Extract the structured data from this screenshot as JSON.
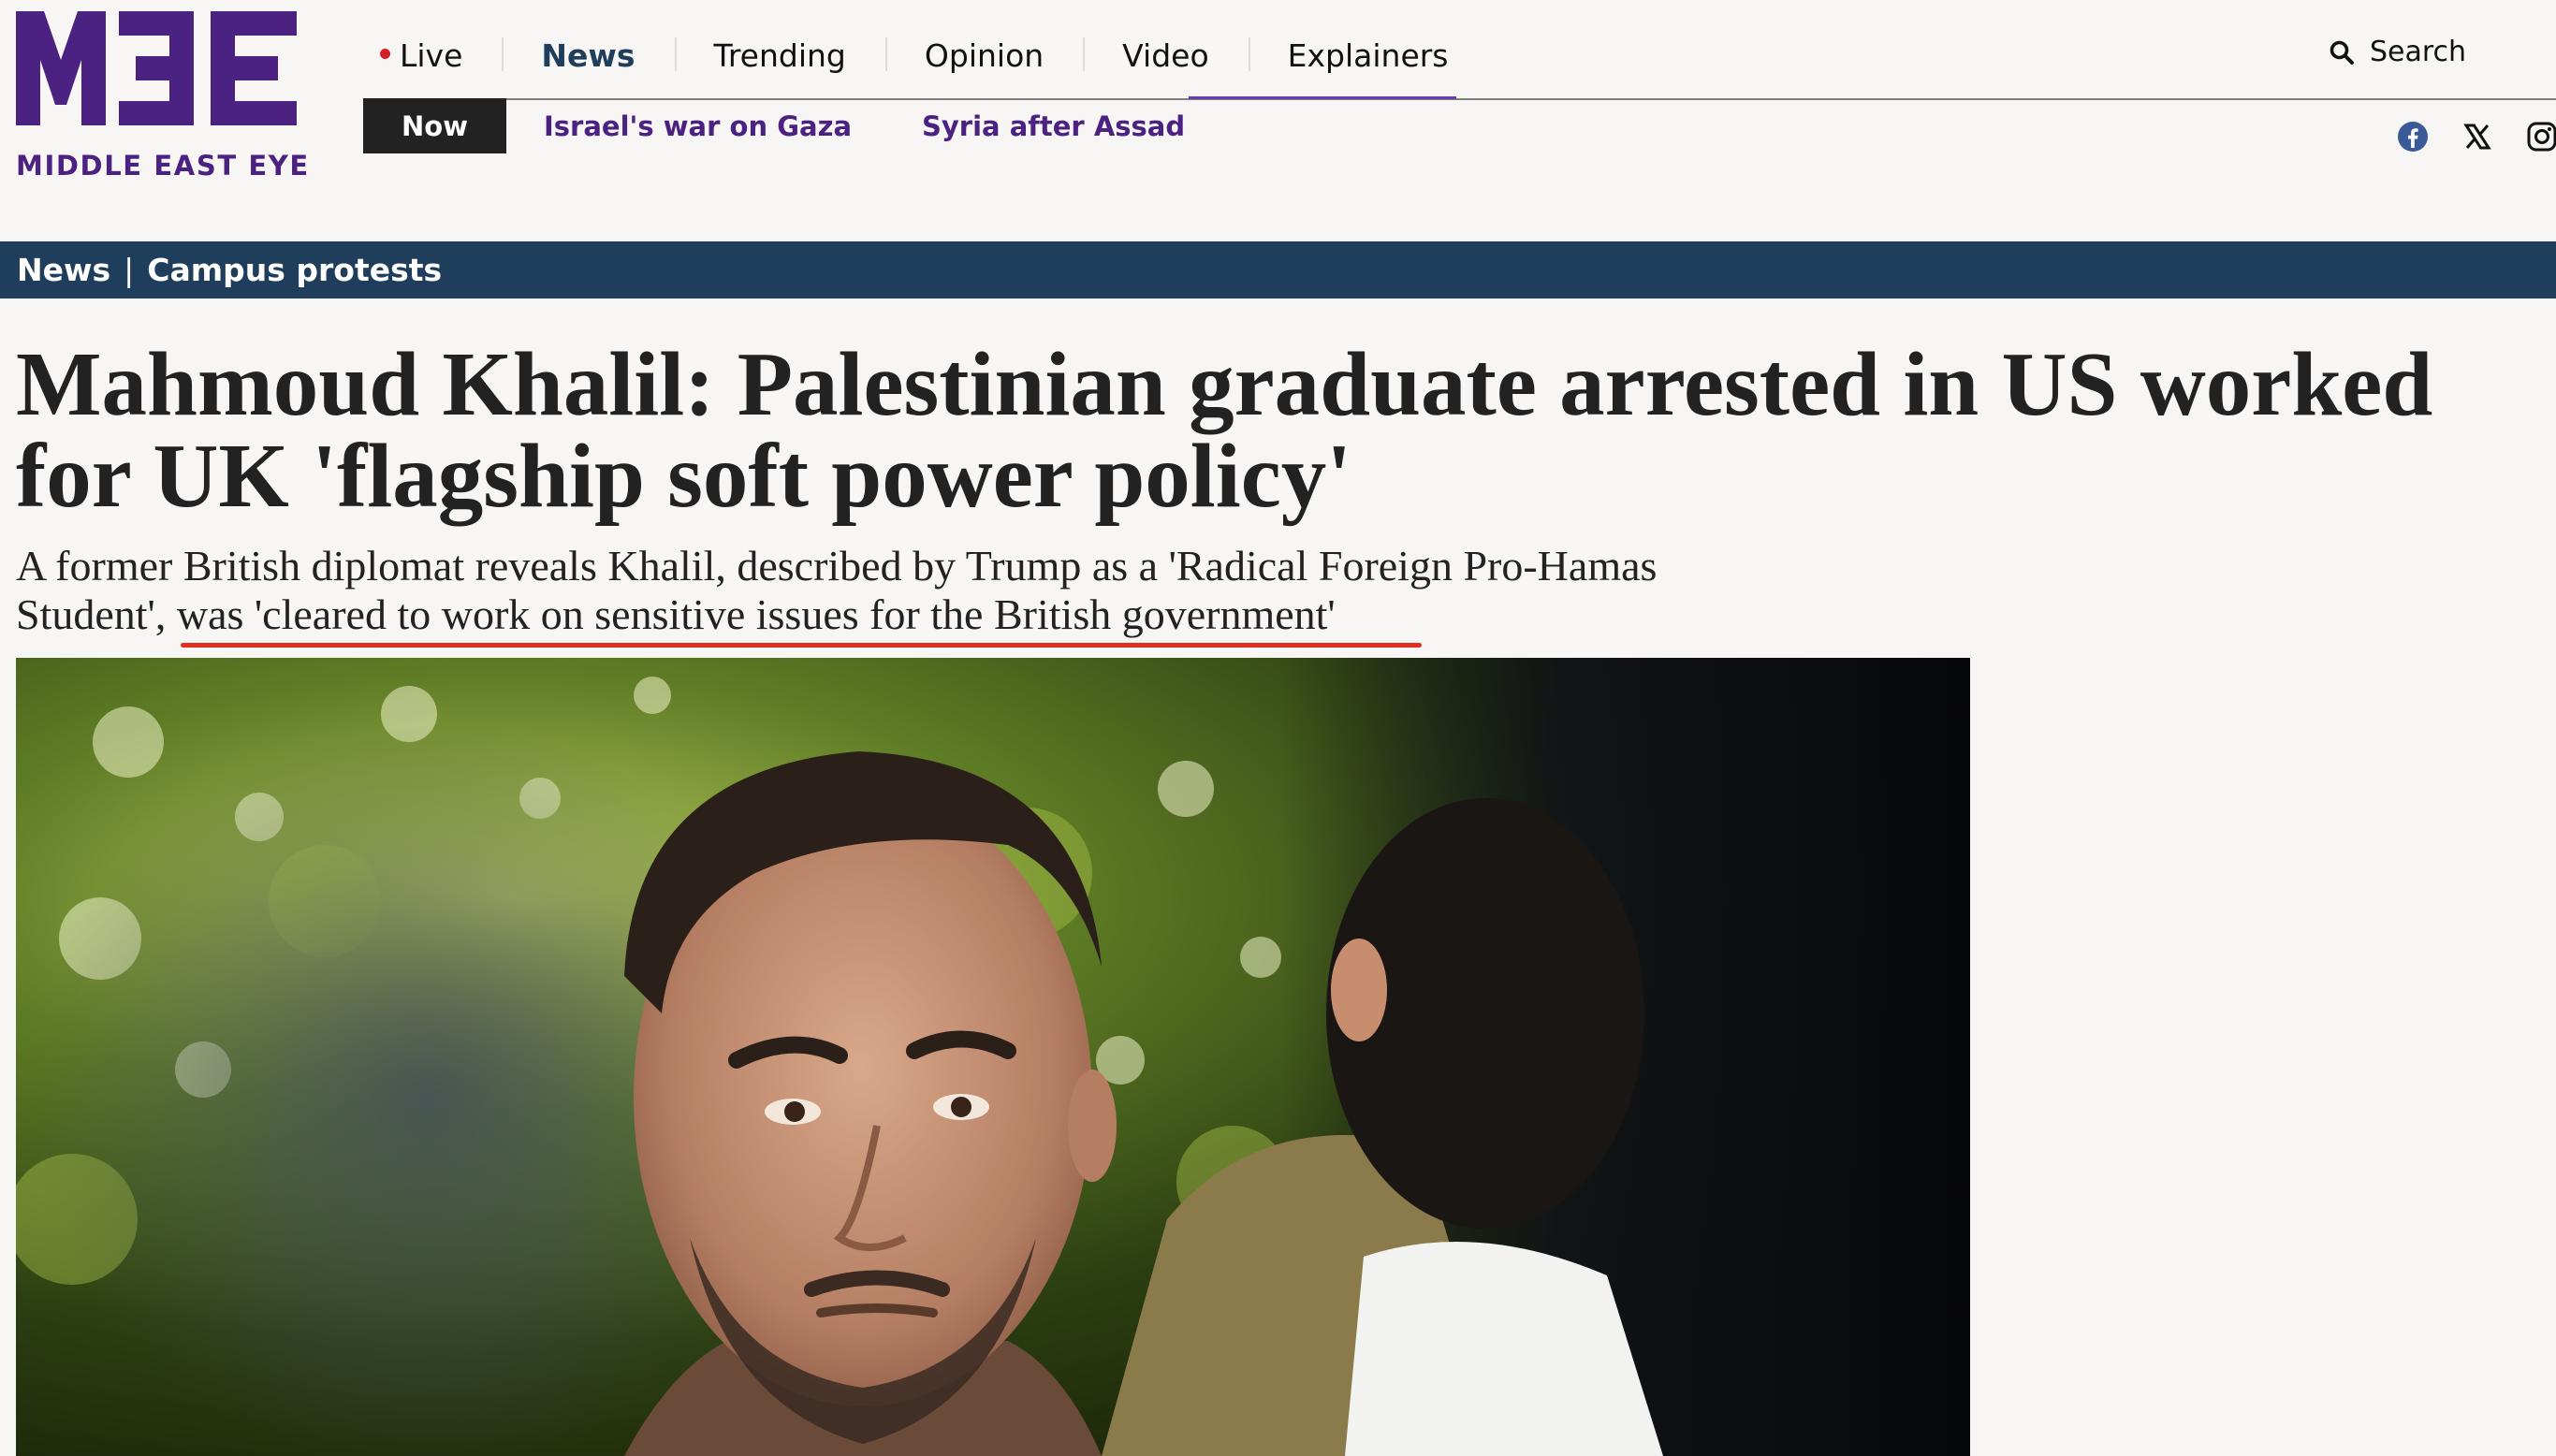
{
  "brand": {
    "name": "MIDDLE EAST EYE",
    "color": "#4b2182"
  },
  "nav": {
    "items": [
      {
        "label": "Live",
        "live": true
      },
      {
        "label": "News",
        "active": true
      },
      {
        "label": "Trending"
      },
      {
        "label": "Opinion"
      },
      {
        "label": "Video"
      },
      {
        "label": "Explainers"
      }
    ],
    "sub": {
      "now_label": "Now",
      "links": [
        "Israel's war on Gaza",
        "Syria after Assad"
      ]
    },
    "search_label": "Search",
    "social_icons": [
      "facebook-icon",
      "x-icon",
      "instagram-icon"
    ]
  },
  "section": {
    "category": "News",
    "separator": "|",
    "topic": "Campus protests",
    "bar_color": "#1f3e5c"
  },
  "article": {
    "headline": "Mahmoud Khalil: Palestinian graduate arrested in US worked for UK 'flagship soft power policy'",
    "standfirst": "A former British diplomat reveals Khalil, described by Trump as a 'Radical Foreign Pro-Hamas Student', was 'cleared to work on sensitive issues for the British government'",
    "underline_color": "#e02d1f"
  },
  "colors": {
    "live_dot": "#d51f27",
    "nav_active": "#1f3e5c",
    "page_bg": "#f7f6f5"
  }
}
